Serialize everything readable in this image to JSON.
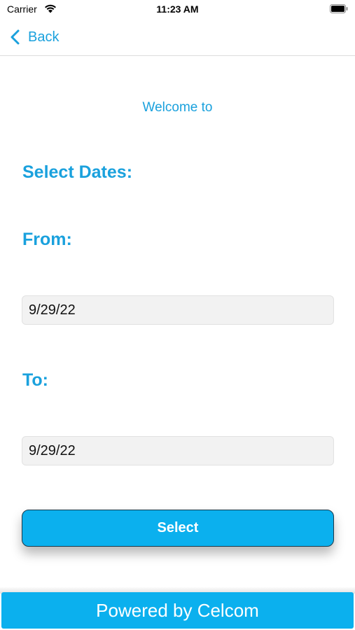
{
  "status_bar": {
    "carrier": "Carrier",
    "time": "11:23 AM",
    "wifi_icon": "wifi-icon",
    "battery_icon": "battery-icon"
  },
  "nav": {
    "back_label": "Back",
    "back_icon": "chevron-left-icon"
  },
  "content": {
    "welcome_text": "Welcome to",
    "select_dates_label": "Select Dates:",
    "from_label": "From:",
    "from_value": "9/29/22",
    "to_label": "To:",
    "to_value": "9/29/22",
    "select_button_label": "Select"
  },
  "footer": {
    "text": "Powered by Celcom"
  },
  "colors": {
    "accent": "#1aa1dd",
    "button": "#0bb0ee",
    "field_bg": "#f2f2f2"
  }
}
